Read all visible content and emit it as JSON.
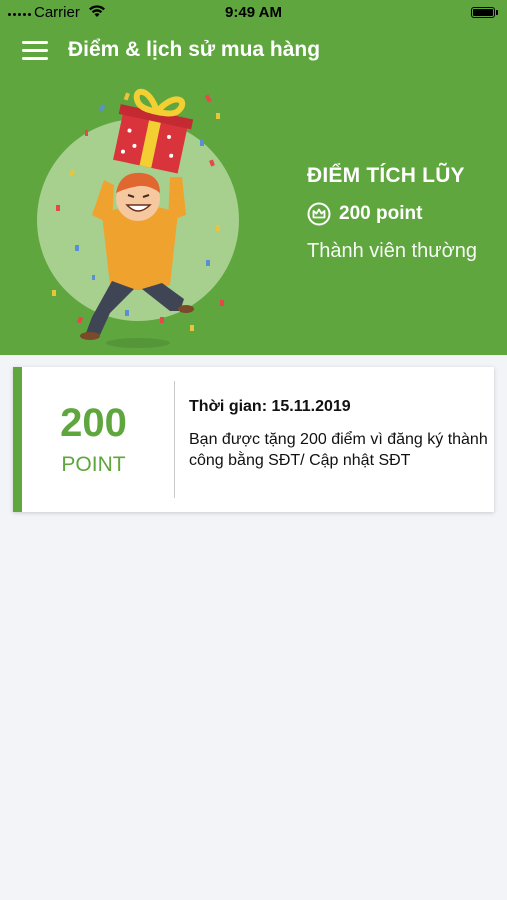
{
  "status_bar": {
    "carrier": "Carrier",
    "time": "9:49 AM"
  },
  "nav": {
    "title": "Điểm & lịch sử mua hàng",
    "menu_icon": "hamburger-menu-icon"
  },
  "summary": {
    "heading": "ĐIỂM TÍCH LŨY",
    "points_icon": "crown-badge-icon",
    "points": "200 point",
    "tier": "Thành viên thường"
  },
  "history": [
    {
      "points": "200",
      "unit": "POINT",
      "time": "Thời gian: 15.11.2019",
      "description": "Bạn được tặng 200 điểm vì đăng ký thành công bằng SĐT/ Cập nhật SĐT"
    }
  ],
  "colors": {
    "brand_green": "#5fa63f",
    "background": "#f2f4f8"
  }
}
